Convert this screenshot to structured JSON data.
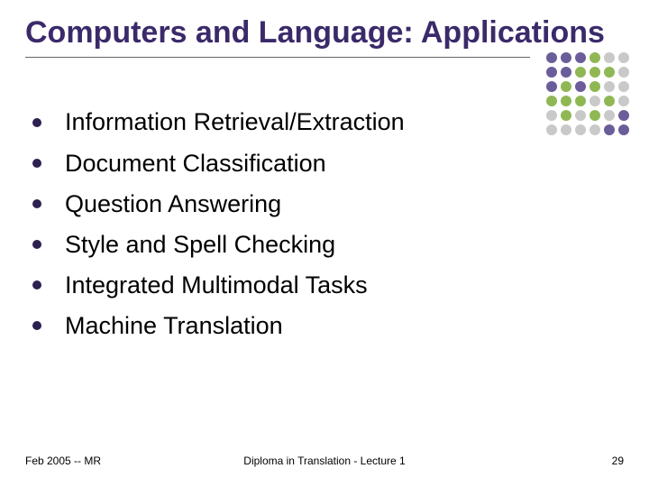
{
  "title": "Computers and Language: Applications",
  "bullets": [
    "Information Retrieval/Extraction",
    "Document Classification",
    "Question Answering",
    "Style and Spell Checking",
    "Integrated Multimodal Tasks",
    "Machine Translation"
  ],
  "footer": {
    "left": "Feb 2005 -- MR",
    "center": "Diploma in Translation - Lecture 1",
    "right": "29"
  },
  "dot_colors": [
    "#6b5d9a",
    "#6b5d9a",
    "#6b5d9a",
    "#8fb855",
    "#c9c9c9",
    "#c9c9c9",
    "#6b5d9a",
    "#6b5d9a",
    "#8fb855",
    "#8fb855",
    "#8fb855",
    "#c9c9c9",
    "#6b5d9a",
    "#8fb855",
    "#6b5d9a",
    "#8fb855",
    "#c9c9c9",
    "#c9c9c9",
    "#8fb855",
    "#8fb855",
    "#8fb855",
    "#c9c9c9",
    "#8fb855",
    "#c9c9c9",
    "#c9c9c9",
    "#8fb855",
    "#c9c9c9",
    "#8fb855",
    "#c9c9c9",
    "#6b5d9a",
    "#c9c9c9",
    "#c9c9c9",
    "#c9c9c9",
    "#c9c9c9",
    "#6b5d9a",
    "#6b5d9a"
  ]
}
